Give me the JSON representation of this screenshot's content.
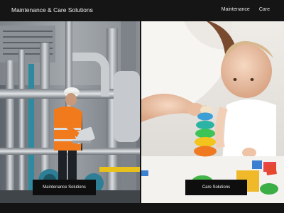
{
  "header": {
    "brand": "Maintenance & Care Solutions",
    "nav": [
      {
        "label": "Maintenance"
      },
      {
        "label": "Care"
      }
    ]
  },
  "panels": {
    "maintenance": {
      "button_label": "Maintenance Solutions"
    },
    "care": {
      "button_label": "Care Solutions"
    }
  },
  "colors": {
    "header_bg": "#151515",
    "button_bg": "#0e0e0e",
    "vest_orange": "#f07a1c",
    "pipe_teal": "#2e8aa0"
  }
}
